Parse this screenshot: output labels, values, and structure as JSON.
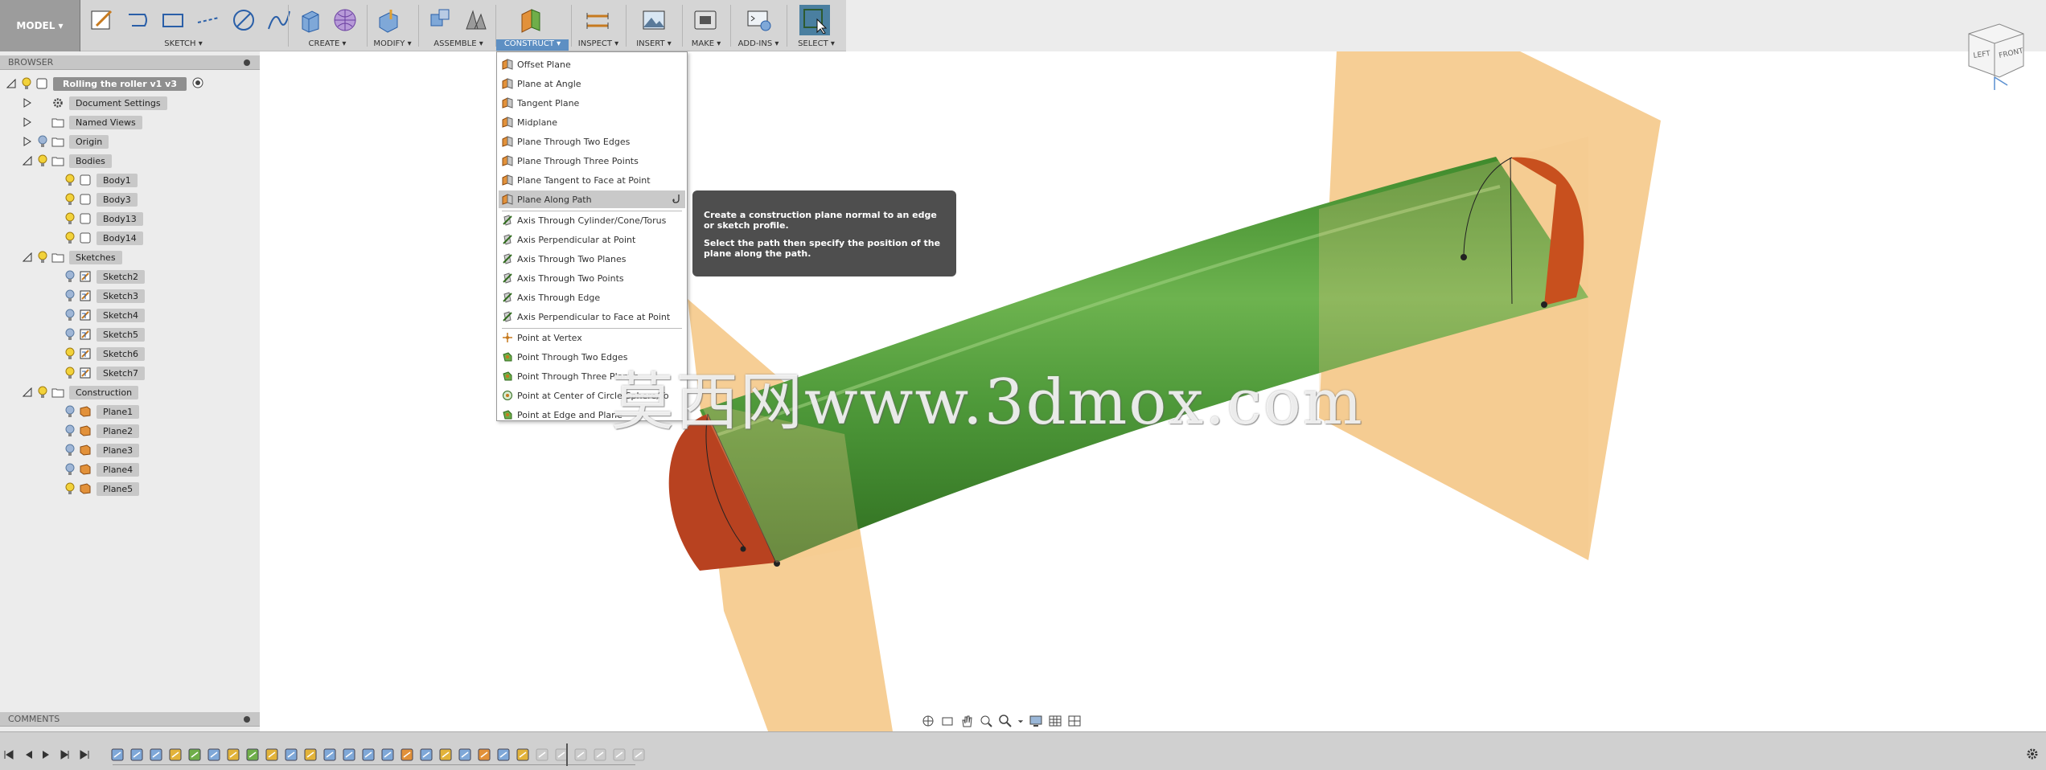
{
  "toolbar": {
    "model_label": "MODEL ▾",
    "groups": [
      {
        "label": "SKETCH ▾"
      },
      {
        "label": "CREATE ▾"
      },
      {
        "label": "MODIFY ▾"
      },
      {
        "label": "ASSEMBLE ▾"
      },
      {
        "label": "CONSTRUCT ▾"
      },
      {
        "label": "INSPECT ▾"
      },
      {
        "label": "INSERT ▾"
      },
      {
        "label": "MAKE ▾"
      },
      {
        "label": "ADD-INS ▾"
      },
      {
        "label": "SELECT ▾"
      }
    ]
  },
  "browser": {
    "title": "BROWSER",
    "root": "Rolling the roller v1 v3",
    "items": [
      {
        "label": "Document Settings"
      },
      {
        "label": "Named Views"
      },
      {
        "label": "Origin"
      },
      {
        "label": "Bodies"
      },
      {
        "label": "Body1"
      },
      {
        "label": "Body3"
      },
      {
        "label": "Body13"
      },
      {
        "label": "Body14"
      },
      {
        "label": "Sketches"
      },
      {
        "label": "Sketch2"
      },
      {
        "label": "Sketch3"
      },
      {
        "label": "Sketch4"
      },
      {
        "label": "Sketch5"
      },
      {
        "label": "Sketch6"
      },
      {
        "label": "Sketch7"
      },
      {
        "label": "Construction"
      },
      {
        "label": "Plane1"
      },
      {
        "label": "Plane2"
      },
      {
        "label": "Plane3"
      },
      {
        "label": "Plane4"
      },
      {
        "label": "Plane5"
      }
    ]
  },
  "comments": {
    "title": "COMMENTS"
  },
  "construct_menu": {
    "items": [
      {
        "label": "Offset Plane"
      },
      {
        "label": "Plane at Angle"
      },
      {
        "label": "Tangent Plane"
      },
      {
        "label": "Midplane"
      },
      {
        "label": "Plane Through Two Edges"
      },
      {
        "label": "Plane Through Three Points"
      },
      {
        "label": "Plane Tangent to Face at Point"
      },
      {
        "label": "Plane Along Path"
      },
      {
        "label": "Axis Through Cylinder/Cone/Torus"
      },
      {
        "label": "Axis Perpendicular at Point"
      },
      {
        "label": "Axis Through Two Planes"
      },
      {
        "label": "Axis Through Two Points"
      },
      {
        "label": "Axis Through Edge"
      },
      {
        "label": "Axis Perpendicular to Face at Point"
      },
      {
        "label": "Point at Vertex"
      },
      {
        "label": "Point Through Two Edges"
      },
      {
        "label": "Point Through Three Planes"
      },
      {
        "label": "Point at Center of Circle/Sphere/To"
      },
      {
        "label": "Point at Edge and Plane"
      }
    ]
  },
  "tooltip": {
    "line1": "Create a construction plane normal to an edge or sketch profile.",
    "line2": "Select the path then specify the position of the plane along the path."
  },
  "watermark": "莫西网www.3dmox.com",
  "viewcube": {
    "left": "LEFT",
    "front": "FRONT"
  },
  "colors": {
    "plane": "#f5c98a",
    "body": "#4f9a3a",
    "endcap": "#c8501e",
    "toolbar_active": "#5d8fc3",
    "tooltip_bg": "#4e4e4e"
  }
}
